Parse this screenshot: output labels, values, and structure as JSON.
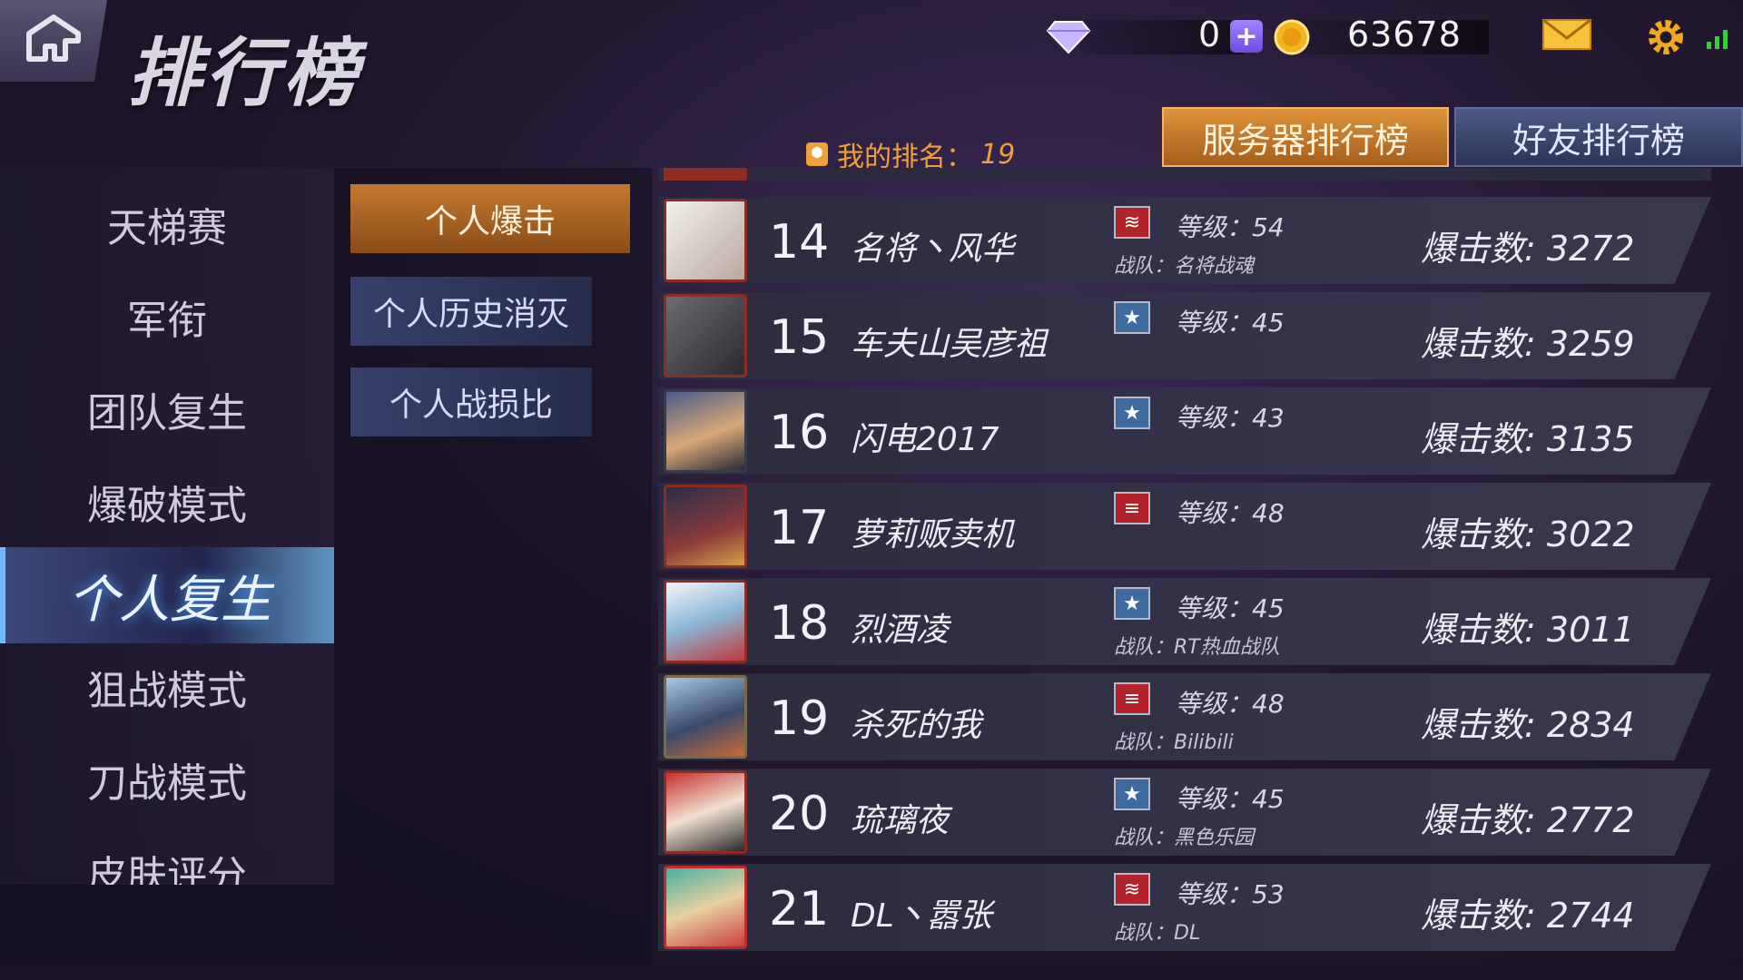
{
  "header": {
    "title": "排行榜",
    "diamond_amount": "0",
    "gold_amount": "63678",
    "my_rank_label": "我的排名：",
    "my_rank_value": "19"
  },
  "tabs": {
    "server": "服务器排行榜",
    "friends": "好友排行榜"
  },
  "sidebar": {
    "items": [
      {
        "label": "天梯赛"
      },
      {
        "label": "军衔"
      },
      {
        "label": "团队复生"
      },
      {
        "label": "爆破模式"
      },
      {
        "label": "个人复生",
        "active": true
      },
      {
        "label": "狙战模式"
      },
      {
        "label": "刀战模式"
      },
      {
        "label": "皮肤评分"
      }
    ]
  },
  "subtabs": [
    {
      "label": "个人爆击",
      "active": true
    },
    {
      "label": "个人历史消灭"
    },
    {
      "label": "个人战损比"
    }
  ],
  "colors": {
    "accent_orange": "#c37a2e",
    "active_blue": "#6fb8ff",
    "badge_red": "#b3242a",
    "badge_blue": "#3e6aa0"
  },
  "partial_row_text": "战队：名将战魂",
  "rows": [
    {
      "rank": "14",
      "name": "名将丶风华",
      "level": "等级：54",
      "team": "战队：名将战魂",
      "kills_label": "爆击数:",
      "kills": "3272",
      "badge_icon": "red-chevron-badge-icon"
    },
    {
      "rank": "15",
      "name": "车夫山吴彦祖",
      "level": "等级：45",
      "team": "",
      "kills_label": "爆击数:",
      "kills": "3259",
      "badge_icon": "blue-star-badge-icon"
    },
    {
      "rank": "16",
      "name": "闪电2017",
      "level": "等级：43",
      "team": "",
      "kills_label": "爆击数:",
      "kills": "3135",
      "badge_icon": "blue-star-badge-icon"
    },
    {
      "rank": "17",
      "name": "萝莉贩卖机",
      "level": "等级：48",
      "team": "",
      "kills_label": "爆击数:",
      "kills": "3022",
      "badge_icon": "red-bar-badge-icon"
    },
    {
      "rank": "18",
      "name": "烈酒凌",
      "level": "等级：45",
      "team": "战队：RT热血战队",
      "kills_label": "爆击数:",
      "kills": "3011",
      "badge_icon": "blue-star-badge-icon"
    },
    {
      "rank": "19",
      "name": "杀死的我",
      "level": "等级：48",
      "team": "战队：Bilibili",
      "kills_label": "爆击数:",
      "kills": "2834",
      "badge_icon": "red-bar-badge-icon"
    },
    {
      "rank": "20",
      "name": "琉璃夜",
      "level": "等级：45",
      "team": "战队：黑色乐园",
      "kills_label": "爆击数:",
      "kills": "2772",
      "badge_icon": "blue-star-badge-icon"
    },
    {
      "rank": "21",
      "name": "DL丶嚣张",
      "level": "等级：53",
      "team": "战队：DL",
      "kills_label": "爆击数:",
      "kills": "2744",
      "badge_icon": "red-chevron-badge-icon"
    }
  ]
}
